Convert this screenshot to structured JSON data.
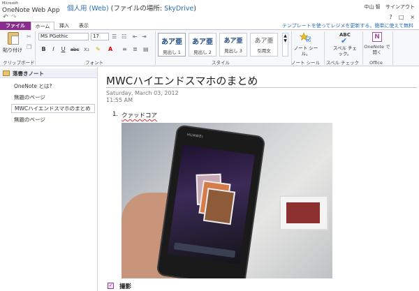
{
  "app": {
    "brand_small": "Microsoft",
    "brand_name": "OneNote Web App",
    "notebook_title": "個人用 (Web)",
    "location_prefix": " (ファイルの場所: ",
    "location_link": "SkyDrive",
    "location_suffix": ")",
    "user_name": "中山 智",
    "sign_out": "サインアウト"
  },
  "quickbar": {
    "undo_icon": "↶",
    "redo_icon": "↷",
    "help_icon": "?",
    "restore_icon": "□",
    "close_icon": "×"
  },
  "tabs": [
    {
      "label": "ファイル"
    },
    {
      "label": "ホーム"
    },
    {
      "label": "挿入"
    },
    {
      "label": "表示"
    }
  ],
  "template_notice": "テンプレートを使ってレジメを更新する。簡単に使えて無料",
  "ribbon": {
    "clipboard": {
      "paste_label": "貼り付け",
      "group_label": "クリップボード"
    },
    "font": {
      "font_name": "MS PGothic",
      "font_size": "17",
      "bold": "B",
      "italic": "I",
      "underline": "U",
      "strike": "abc",
      "group_label": "フォント"
    },
    "styles": {
      "tiles": [
        {
          "sample": "あア亜",
          "label": "見出し 1"
        },
        {
          "sample": "あア亜",
          "label": "見出し 2"
        },
        {
          "sample": "あア亜",
          "label": "見出し 3"
        },
        {
          "sample": "あア亜",
          "label": "引用文"
        }
      ],
      "group_label": "スタイル"
    },
    "tags": {
      "button_label": "ノート シール。",
      "group_label": "ノート シール"
    },
    "spelling": {
      "abc": "ABC",
      "button_label": "スペル チェック。",
      "group_label": "スペル チェック"
    },
    "office": {
      "button_label": "OneNote で開く",
      "group_label": "Office"
    }
  },
  "nav": {
    "section": "落書きノート",
    "pages": [
      {
        "label": "OneNote とは?"
      },
      {
        "label": "無題のページ"
      },
      {
        "label": "MWCハイエンドスマホのまとめ"
      },
      {
        "label": "無題のページ"
      }
    ]
  },
  "page": {
    "title": "MWCハイエンドスマホのまとめ",
    "date": "Saturday, March 03, 2012",
    "time": "11:55 AM",
    "list_number": "1.",
    "list_item": "クァッドコア",
    "phone_brand": "HUAWEI",
    "todo_check": "✓",
    "todo_text": "撮影"
  }
}
